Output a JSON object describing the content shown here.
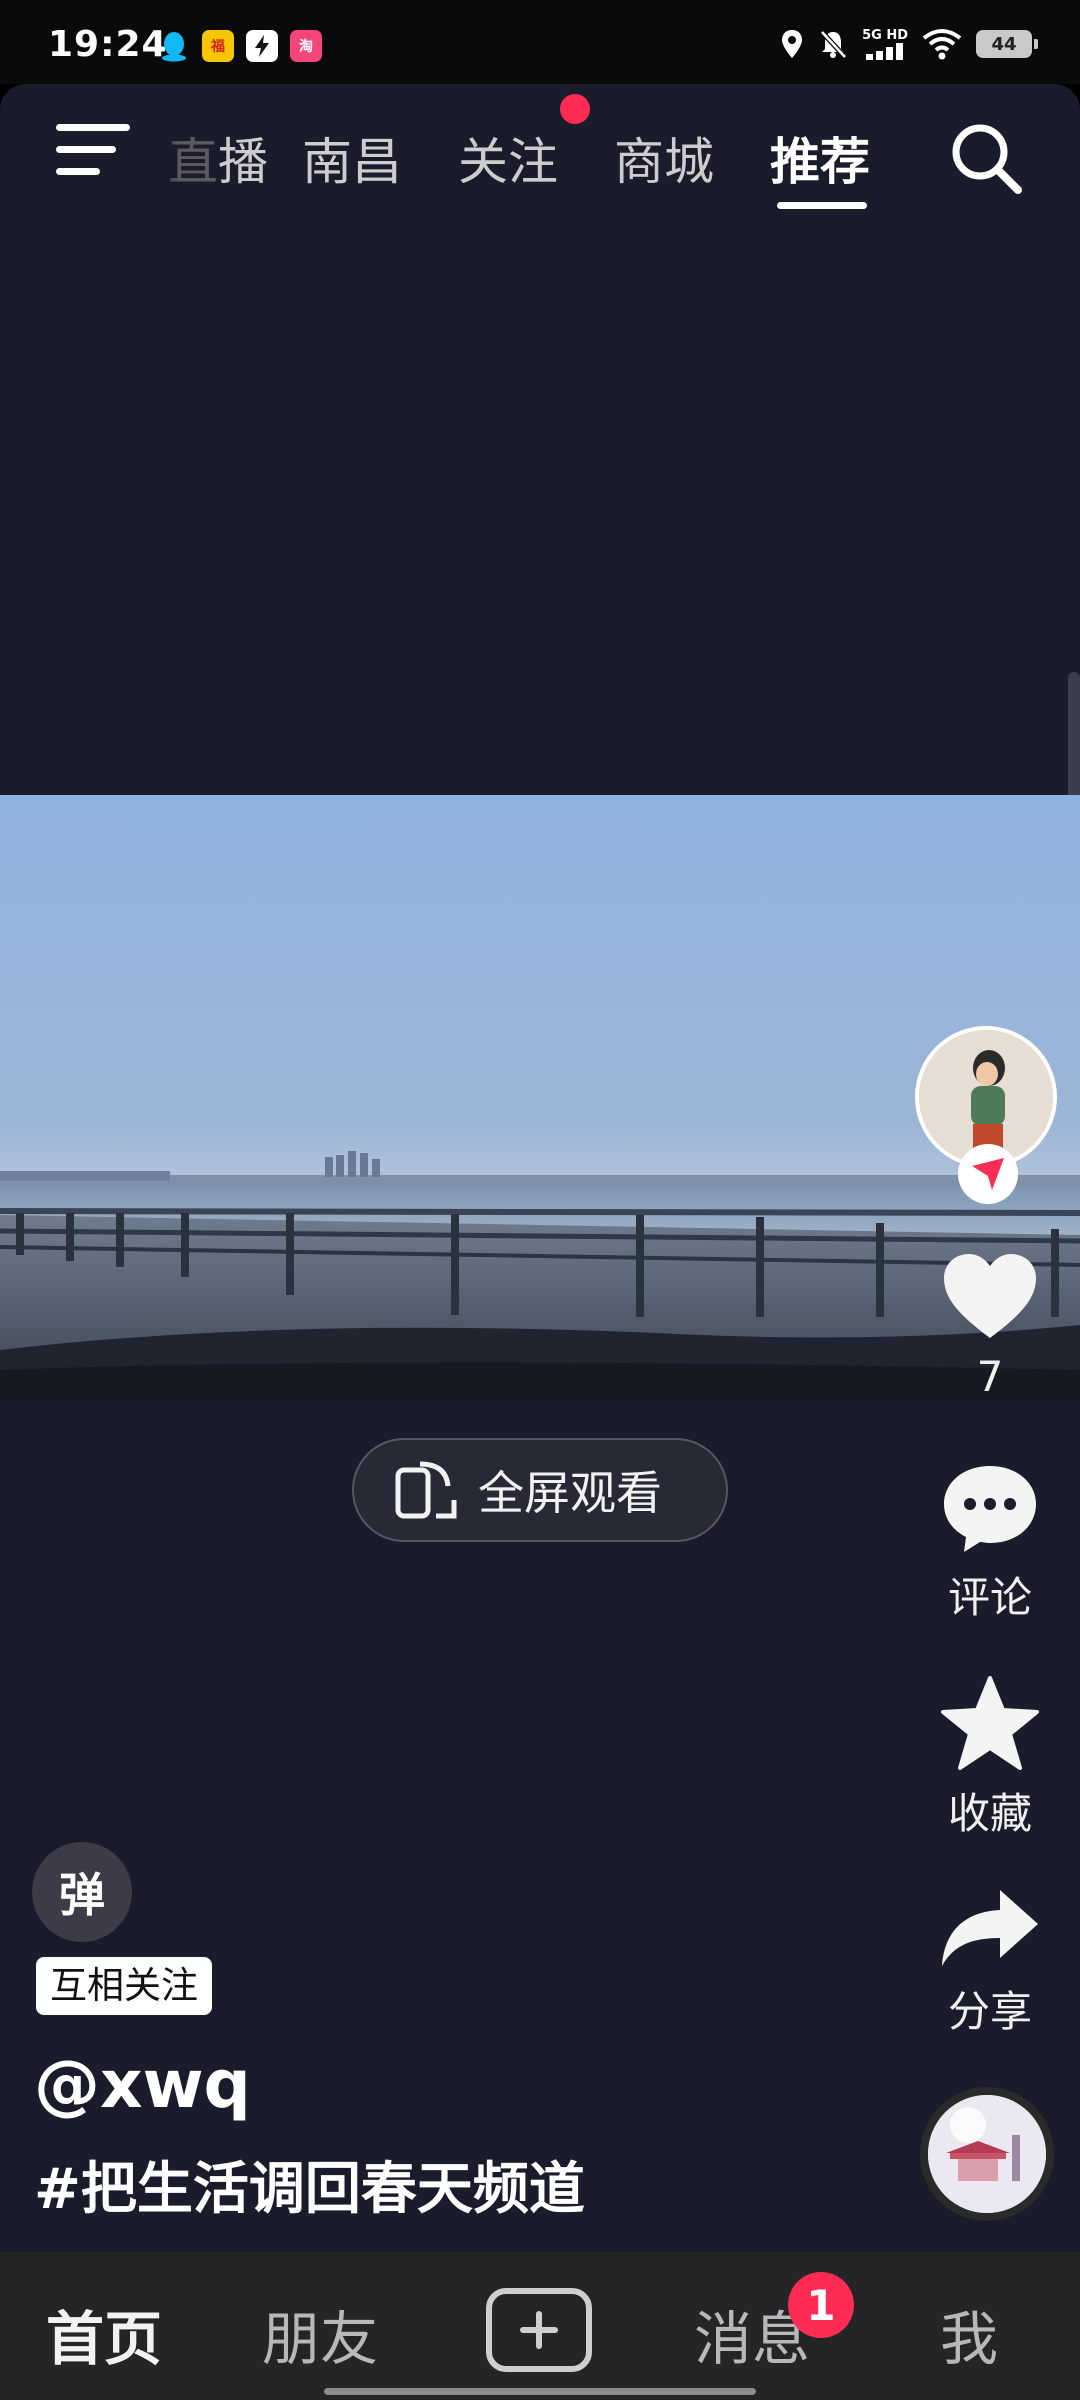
{
  "status_bar": {
    "time": "19:24",
    "network": "5G HD",
    "battery": "44",
    "icons": [
      "qq-icon",
      "app-icon-2",
      "app-icon-3",
      "app-icon-4",
      "location-icon",
      "mute-bell-icon",
      "signal-icon",
      "wifi-icon",
      "battery-icon"
    ]
  },
  "top_nav": {
    "tabs": [
      {
        "label": "直播",
        "visible": "播"
      },
      {
        "label": "南昌"
      },
      {
        "label": "关注"
      },
      {
        "label": "商城"
      },
      {
        "label": "推荐"
      }
    ],
    "active_tab": "推荐",
    "partial_prefix": "直"
  },
  "video": {
    "fullscreen_label": "全屏观看"
  },
  "actions": {
    "like_count": "7",
    "comment_label": "评论",
    "favorite_label": "收藏",
    "share_label": "分享"
  },
  "info": {
    "danmaku": "弹",
    "mutual_badge": "互相关注",
    "author": "@xwq",
    "caption": "#把生活调回春天频道"
  },
  "bottom_nav": {
    "home": "首页",
    "friends": "朋友",
    "messages": "消息",
    "messages_badge": "1",
    "me": "我"
  },
  "colors": {
    "background": "#1b1c2b",
    "accent": "#fe2c55",
    "bottom_bar": "#252527"
  }
}
